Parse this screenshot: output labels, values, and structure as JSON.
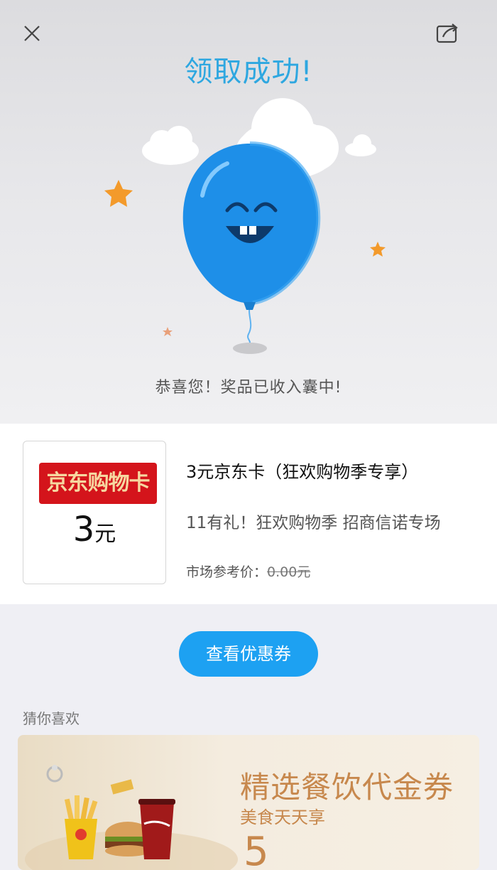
{
  "header": {
    "close_icon": "close-icon",
    "share_icon": "share-icon",
    "title": "领取成功!"
  },
  "hero": {
    "message": "恭喜您！奖品已收入囊中!",
    "colors": {
      "balloon": "#1e8fe8",
      "star": "#f39a2b"
    }
  },
  "prize": {
    "thumb_label": "京东购物卡",
    "thumb_amount": "3",
    "thumb_unit": "元",
    "title": "3元京东卡（狂欢购物季专享）",
    "description": "11有礼！狂欢购物季 招商信诺专场",
    "price_label": "市场参考价：",
    "price_value": "0.00元"
  },
  "actions": {
    "view_coupon": "查看优惠券"
  },
  "recommend": {
    "heading": "猜你喜欢",
    "banner": {
      "title": "精选餐饮代金券",
      "subtitle": "美食天天享",
      "big": "5"
    }
  },
  "colors": {
    "accent": "#1da1f2",
    "title": "#2ea7e0",
    "badge": "#d4141b",
    "banner_text": "#c7884d"
  }
}
